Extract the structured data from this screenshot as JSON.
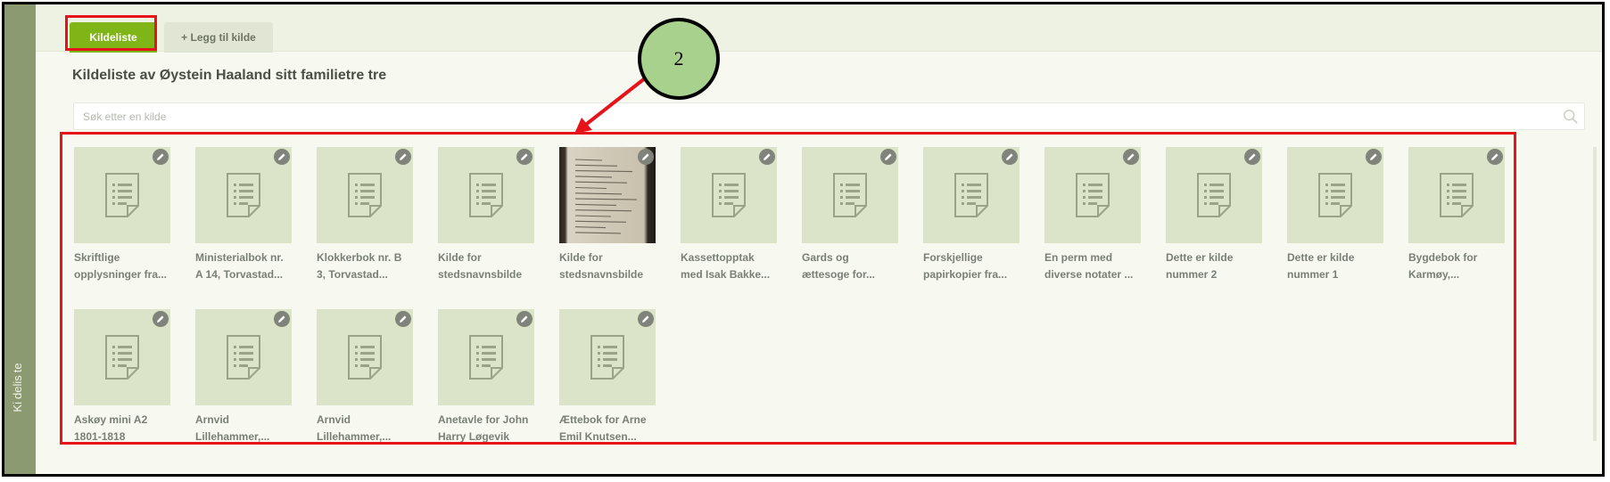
{
  "tabs": {
    "active_label": "Kildeliste",
    "add_label": "+ Legg til kilde"
  },
  "side_panel": {
    "label_part1": "Ki",
    "label_part2": "delis",
    "label_part3": "te"
  },
  "page_title": "Kildeliste av Øystein Haaland sitt familietre tre",
  "search": {
    "placeholder": "Søk etter en kilde",
    "value": ""
  },
  "callout": {
    "number": "2"
  },
  "sources": [
    {
      "line1": "Skriftlige",
      "line2": "opplysninger fra...",
      "thumbnail": "document-icon"
    },
    {
      "line1": "Ministerialbok nr.",
      "line2": "A 14, Torvastad...",
      "thumbnail": "document-icon"
    },
    {
      "line1": "Klokkerbok nr. B",
      "line2": "3, Torvastad...",
      "thumbnail": "document-icon"
    },
    {
      "line1": "Kilde for",
      "line2": "stedsnavnsbilde",
      "thumbnail": "document-icon"
    },
    {
      "line1": "Kilde for",
      "line2": "stedsnavnsbilde",
      "thumbnail": "photo"
    },
    {
      "line1": "Kassettopptak",
      "line2": "med Isak Bakke...",
      "thumbnail": "document-icon"
    },
    {
      "line1": "Gards og",
      "line2": "ættesoge for...",
      "thumbnail": "document-icon"
    },
    {
      "line1": "Forskjellige",
      "line2": "papirkopier fra...",
      "thumbnail": "document-icon"
    },
    {
      "line1": "En perm med",
      "line2": "diverse notater ...",
      "thumbnail": "document-icon"
    },
    {
      "line1": "Dette er kilde",
      "line2": "nummer 2",
      "thumbnail": "document-icon"
    },
    {
      "line1": "Dette er kilde",
      "line2": "nummer 1",
      "thumbnail": "document-icon"
    },
    {
      "line1": "Bygdebok for",
      "line2": "Karmøy,...",
      "thumbnail": "document-icon"
    },
    {
      "line1": "Askøy mini A2",
      "line2": "1801-1818",
      "thumbnail": "document-icon"
    },
    {
      "line1": "Arnvid",
      "line2": "Lillehammer,...",
      "thumbnail": "document-icon"
    },
    {
      "line1": "Arnvid",
      "line2": "Lillehammer,...",
      "thumbnail": "document-icon"
    },
    {
      "line1": "Anetavle for John",
      "line2": "Harry Løgevik",
      "thumbnail": "document-icon"
    },
    {
      "line1": "Ættebok for Arne",
      "line2": "Emil Knutsen...",
      "thumbnail": "document-icon"
    }
  ],
  "colors": {
    "accent_green": "#7fb517",
    "annotation_red": "#e6141a",
    "callout_fill": "#a9d18e",
    "thumb_bg": "#dbe4c9"
  }
}
